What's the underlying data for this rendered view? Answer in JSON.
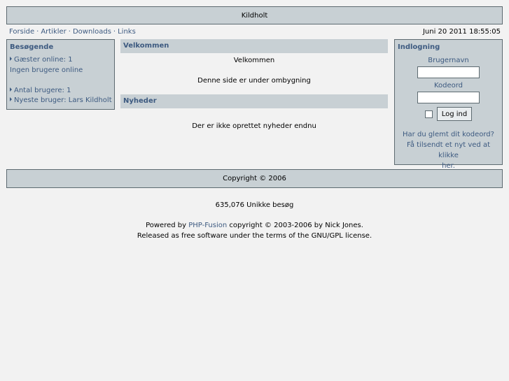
{
  "header": {
    "title": "Kildholt"
  },
  "nav": {
    "links": [
      "Forside",
      "Artikler",
      "Downloads",
      "Links"
    ],
    "separator": "·",
    "datetime": "Juni 20 2011 18:55:05"
  },
  "visitors": {
    "title": "Besøgende",
    "guests": "Gæster online: 1",
    "no_users": "Ingen brugere online",
    "member_count": "Antal brugere: 1",
    "newest_user": "Nyeste bruger: Lars Kildholt"
  },
  "welcome": {
    "title": "Velkommen",
    "heading": "Velkommen",
    "text": "Denne side er under ombygning"
  },
  "news": {
    "title": "Nyheder",
    "text": "Der er ikke oprettet nyheder endnu"
  },
  "login": {
    "title": "Indlogning",
    "username_label": "Brugernavn",
    "password_label": "Kodeord",
    "username_value": "",
    "password_value": "",
    "button_label": "Log ind",
    "forgot_line1": "Har du glemt dit kodeord?",
    "forgot_line2": "Få tilsendt et nyt ved at klikke",
    "forgot_line3": "her."
  },
  "footer": {
    "copyright": "Copyright © 2006",
    "visits": "635,076 Unikke besøg",
    "powered_prefix": "Powered by ",
    "powered_link": "PHP-Fusion",
    "powered_suffix": " copyright © 2003-2006 by Nick Jones.",
    "license": "Released as free software under the terms of the GNU/GPL license."
  },
  "colors": {
    "panel_bg": "#c8d0d4",
    "border": "#5d6a70",
    "link": "#3d5a80",
    "page_bg": "#f2f2f2"
  }
}
